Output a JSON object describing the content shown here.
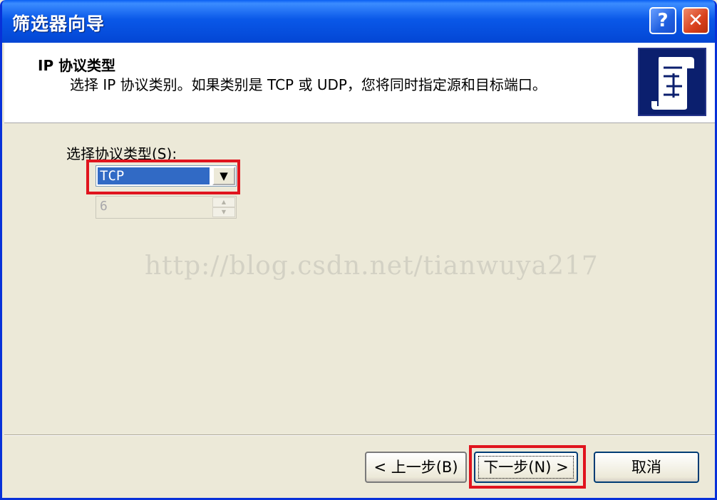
{
  "window": {
    "title": "筛选器向导",
    "help_glyph": "?",
    "close_glyph": "✕"
  },
  "header": {
    "title": "IP 协议类型",
    "description": "选择 IP 协议类别。如果类别是 TCP 或 UDP，您将同时指定源和目标端口。"
  },
  "protocol": {
    "label_text": "选择协议类型",
    "label_hotkey": "(S)",
    "label_suffix": ":",
    "selected_value": "TCP",
    "dropdown_glyph": "▼",
    "number_value": "6",
    "spin_up_glyph": "▲",
    "spin_down_glyph": "▼"
  },
  "watermark": "http://blog.csdn.net/tianwuya217",
  "buttons": {
    "back_label": "< 上一步(B)",
    "next_label": "下一步(N) >",
    "cancel_label": "取消"
  },
  "colors": {
    "titlebar": "#0a58e8",
    "selection": "#316ac5",
    "highlight_box": "#e0141e",
    "dialog_bg": "#ece9d8"
  },
  "icons": {
    "header_icon": "scroll-icon"
  }
}
